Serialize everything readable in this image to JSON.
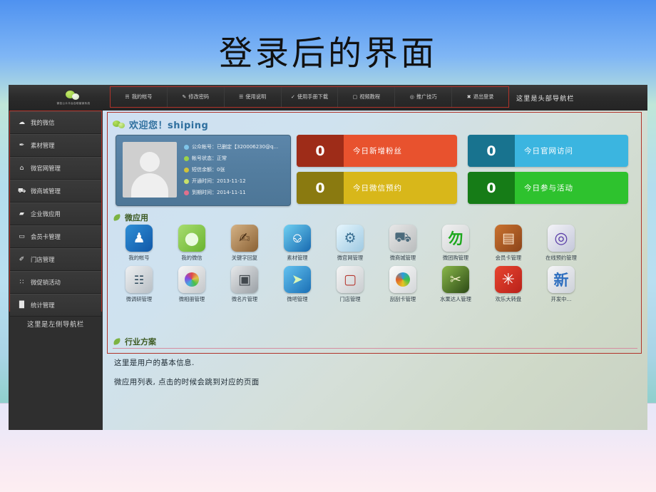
{
  "slide": {
    "title": "登录后的界面"
  },
  "header": {
    "logo_text": "微信公众平台自助营销系统",
    "note": "这里是头部导航栏",
    "nav": [
      {
        "label": "我的帐号",
        "icon": "user-icon",
        "glyph": "☴"
      },
      {
        "label": "修改密码",
        "icon": "pencil-icon",
        "glyph": "✎"
      },
      {
        "label": "使用说明",
        "icon": "list-icon",
        "glyph": "☰"
      },
      {
        "label": "使用手册下载",
        "icon": "check-icon",
        "glyph": "✓"
      },
      {
        "label": "视频教程",
        "icon": "video-icon",
        "glyph": "▢"
      },
      {
        "label": "推广技巧",
        "icon": "globe-icon",
        "glyph": "◎"
      },
      {
        "label": "退出登录",
        "icon": "exit-icon",
        "glyph": "✖"
      }
    ]
  },
  "sidebar": {
    "note": "这里是左侧导航栏",
    "items": [
      {
        "label": "我的微信",
        "icon": "chat-bubble-icon",
        "glyph": "☁"
      },
      {
        "label": "素材管理",
        "icon": "brush-icon",
        "glyph": "✒"
      },
      {
        "label": "微官网管理",
        "icon": "home-icon",
        "glyph": "⌂"
      },
      {
        "label": "微商城管理",
        "icon": "cart-icon",
        "glyph": "⛟"
      },
      {
        "label": "企业微应用",
        "icon": "speaker-icon",
        "glyph": "▰"
      },
      {
        "label": "会员卡管理",
        "icon": "card-icon",
        "glyph": "▭"
      },
      {
        "label": "门店管理",
        "icon": "pen-icon",
        "glyph": "✐"
      },
      {
        "label": "微促销活动",
        "icon": "grid-icon",
        "glyph": "∷"
      },
      {
        "label": "统计管理",
        "icon": "chart-bar-icon",
        "glyph": "█"
      }
    ]
  },
  "content": {
    "welcome": "欢迎您！shiping",
    "profile": {
      "lines": [
        {
          "text": "公众帐号：已删定【320006230@q...",
          "dot": "#7fc4e8"
        },
        {
          "text": "帐号状态：正常",
          "dot": "#9cd24a"
        },
        {
          "text": "短信余额：0张",
          "dot": "#d0c23a"
        },
        {
          "text": "开通时间：2013-11-12",
          "dot": "#c8e06a"
        },
        {
          "text": "到期时间：2014-11-11",
          "dot": "#e0708c"
        }
      ]
    },
    "tiles": [
      {
        "value": "0",
        "label": "今日新增粉丝",
        "color": "#e8522e"
      },
      {
        "value": "0",
        "label": "今日官网访问",
        "color": "#3bb5e0"
      },
      {
        "value": "0",
        "label": "今日微信预约",
        "color": "#d8b71a"
      },
      {
        "value": "0",
        "label": "今日参与活动",
        "color": "#2ec22e"
      }
    ],
    "apps_heading": "微应用",
    "apps_row1": [
      {
        "label": "我的帐号",
        "icon": "account-icon",
        "glyph": "♟",
        "bg": "linear-gradient(135deg,#2f8fd6,#1158a8)"
      },
      {
        "label": "我的微信",
        "icon": "wechat-icon",
        "glyph": "●",
        "bg": "linear-gradient(135deg,#a8dd70,#69b32f)"
      },
      {
        "label": "关键字回复",
        "icon": "keyword-reply-icon",
        "glyph": "✍",
        "bg": "linear-gradient(135deg,#d5b285,#8a6134)"
      },
      {
        "label": "素材管理",
        "icon": "material-icon",
        "glyph": "⎙",
        "bg": "linear-gradient(135deg,#6fd0f2,#1769b0)"
      },
      {
        "label": "微官网管理",
        "icon": "website-icon",
        "glyph": "⚙",
        "bg": "linear-gradient(135deg,#e6f6fd,#9ec9e2)"
      },
      {
        "label": "微商城管理",
        "icon": "shop-cart-icon",
        "glyph": "⛟",
        "bg": "linear-gradient(135deg,#e8e8e8,#b9bcbd)"
      },
      {
        "label": "微团购管理",
        "icon": "groupbuy-icon",
        "glyph": "↯",
        "bg": "linear-gradient(135deg,#f1f1f1,#cfd2d3)"
      },
      {
        "label": "会员卡管理",
        "icon": "member-card-icon",
        "glyph": "▤",
        "bg": "linear-gradient(135deg,#c9722f,#8c441a)"
      },
      {
        "label": "在线预约管理",
        "icon": "booking-icon",
        "glyph": "◎",
        "bg": "linear-gradient(135deg,#f4f4f8,#c4c7da)"
      }
    ],
    "apps_row2": [
      {
        "label": "微调研管理",
        "icon": "survey-icon",
        "glyph": "☷",
        "bg": "linear-gradient(135deg,#eef0f2,#b7bec4)"
      },
      {
        "label": "微相册管理",
        "icon": "photo-album-icon",
        "glyph": "◉",
        "bg": "linear-gradient(135deg,#f7f7f7,#c3c6c9)"
      },
      {
        "label": "微名片管理",
        "icon": "namecard-icon",
        "glyph": "▣",
        "bg": "linear-gradient(135deg,#e6e8ea,#9aa0a5)"
      },
      {
        "label": "微吧管理",
        "icon": "paperplane-icon",
        "glyph": "➤",
        "bg": "linear-gradient(135deg,#63c2f0,#1a6fb5)"
      },
      {
        "label": "门店管理",
        "icon": "store-icon",
        "glyph": "⌂",
        "bg": "linear-gradient(135deg,#f5f5f5,#c8cccf)"
      },
      {
        "label": "刮刮卡管理",
        "icon": "scratchcard-icon",
        "glyph": "◌",
        "bg": "linear-gradient(135deg,#fafafa,#d3d6d8)"
      },
      {
        "label": "水果达人管理",
        "icon": "fruit-ninja-icon",
        "glyph": "✂",
        "bg": "linear-gradient(135deg,#6f9d3c,#2c4a16)"
      },
      {
        "label": "欢乐大转盘",
        "icon": "wheel-icon",
        "glyph": "✳",
        "bg": "linear-gradient(135deg,#e8452f,#b8211a)"
      },
      {
        "label": "开发中...",
        "icon": "new-icon",
        "glyph": "新",
        "bg": "linear-gradient(135deg,#f6f6f8,#ccd0d8)"
      }
    ],
    "industry_heading": "行业方案",
    "descriptions": [
      "这里是用户的基本信息.",
      "微应用列表, 点击的时候会跳到对应的页面"
    ]
  }
}
